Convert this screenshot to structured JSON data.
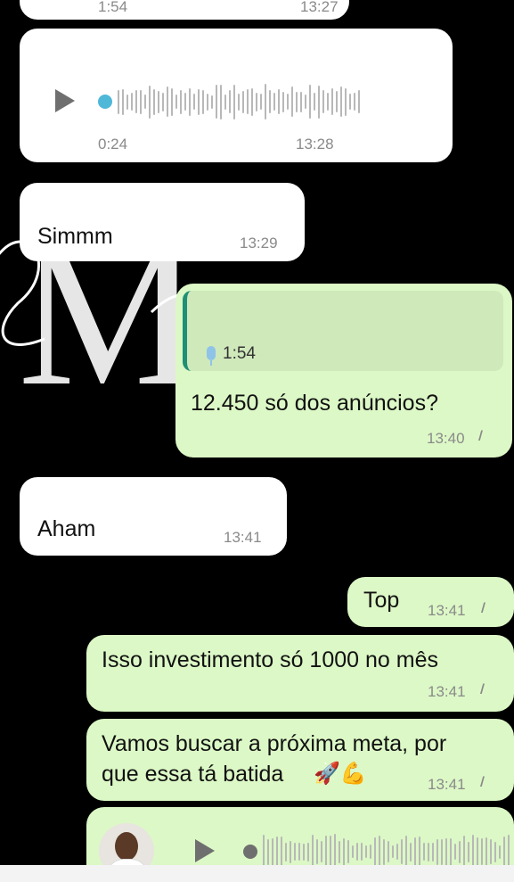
{
  "messages": {
    "top_partial": {
      "left_time": "1:54",
      "right_time": "13:27"
    },
    "audio_in": {
      "duration": "0:24",
      "time": "13:28"
    },
    "simmm": {
      "text": "Simmm",
      "time": "13:29"
    },
    "reply": {
      "quoted_duration": "1:54",
      "text": "12.450 só dos anúncios?",
      "time": "13:40"
    },
    "aham": {
      "text": "Aham",
      "time": "13:41"
    },
    "top": {
      "text": "Top",
      "time": "13:41"
    },
    "investimento": {
      "text": "Isso investimento só 1000 no mês",
      "time": "13:41"
    },
    "meta": {
      "line1": "Vamos buscar a próxima meta, por",
      "line2": "que essa tá batida",
      "emoji": "🚀💪",
      "time": "13:41"
    }
  },
  "icons": {
    "play": "play-icon",
    "mic": "mic-icon",
    "read_receipt": "double-check-icon"
  },
  "colors": {
    "incoming_bubble": "#ffffff",
    "outgoing_bubble": "#dcf8c6",
    "progress_dot": "#4fb8d8",
    "reply_accent": "#1f8f76"
  }
}
